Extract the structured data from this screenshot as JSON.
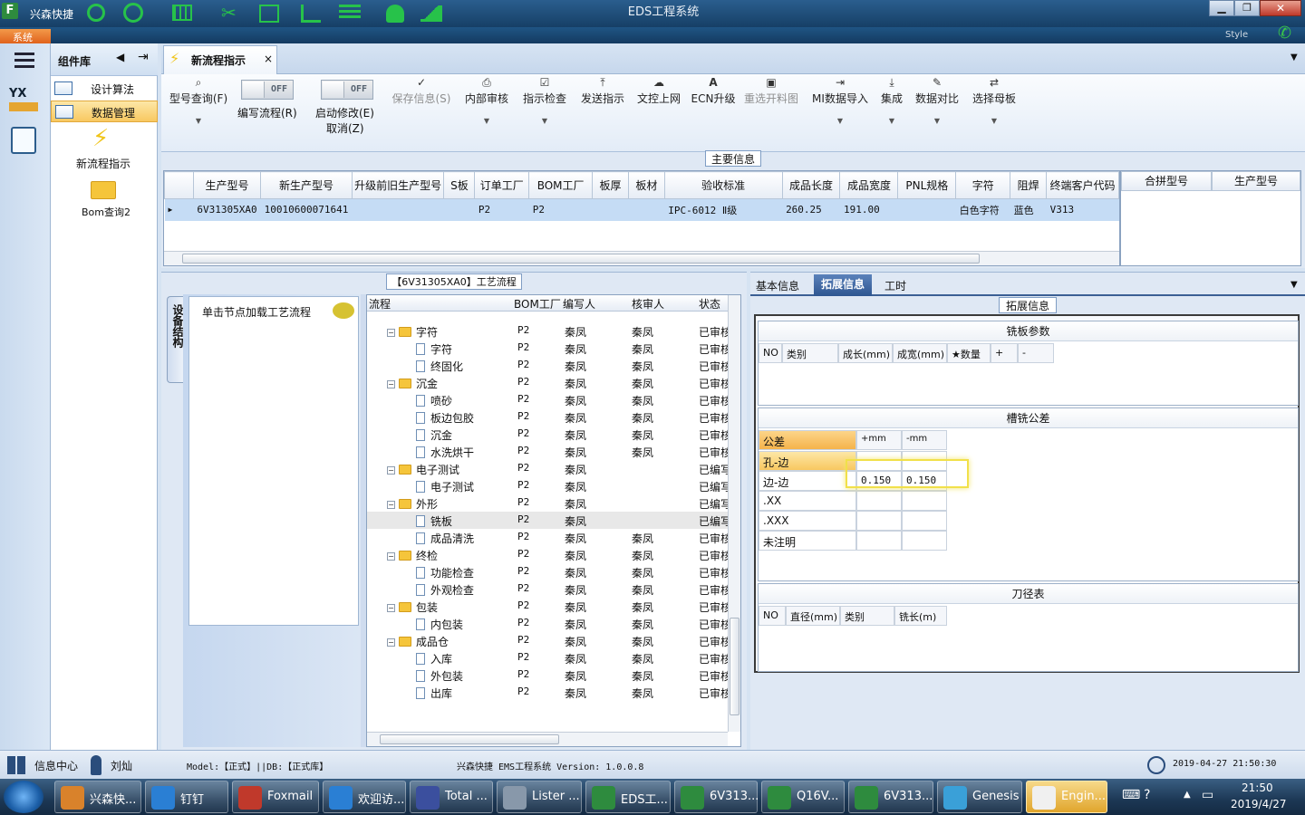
{
  "titlebar": {
    "app_short": "兴森快捷",
    "window_title": "EDS工程系统",
    "style_label": "Style"
  },
  "sysmenu": {
    "label": "系统"
  },
  "component_lib": {
    "title": "组件库",
    "items": [
      "设计算法",
      "数据管理"
    ],
    "tools": [
      "新流程指示",
      "Bom查询2"
    ]
  },
  "doc_tab": {
    "label": "新流程指示",
    "close": "×"
  },
  "ribbon": {
    "model_query": "型号查询(F)",
    "edit_flow_toggle": "OFF",
    "edit_flow": "编写流程(R)",
    "start_modify_toggle": "OFF",
    "start_modify": "启动修改(E)",
    "cancel": "取消(Z)",
    "save_info": "保存信息(S)",
    "internal_review": "内部审核",
    "indicate_check": "指示检查",
    "send_indicate": "发送指示",
    "doc_upload": "文控上网",
    "ecn_upgrade": "ECN升级",
    "reselect_chart": "重选开料图",
    "mi_import": "MI数据导入",
    "integrate": "集成",
    "data_compare": "数据对比",
    "select_mother": "选择母板"
  },
  "main_info": {
    "title": "主要信息",
    "columns": [
      "生产型号",
      "新生产型号",
      "升级前旧生产型号",
      "S板",
      "订单工厂",
      "BOM工厂",
      "板厚",
      "板材",
      "验收标准",
      "成品长度",
      "成品宽度",
      "PNL规格",
      "字符",
      "阻焊",
      "终端客户代码"
    ],
    "row": [
      "6V31305XA0",
      "10010600071641",
      "",
      "",
      "P2",
      "P2",
      "",
      "",
      "IPC-6012 Ⅱ级",
      "260.25",
      "191.00",
      "",
      "白色字符",
      "蓝色",
      "V313"
    ],
    "side_columns": [
      "合拼型号",
      "生产型号"
    ]
  },
  "process": {
    "title": "【6V31305XA0】工艺流程",
    "vertical_tab": "设备结构",
    "hint": "单击节点加载工艺流程",
    "columns": [
      "流程",
      "BOM工厂",
      "编写人",
      "核审人",
      "状态"
    ],
    "rows": [
      {
        "name": "字符",
        "folder": true,
        "bom": "P2",
        "author": "秦凤",
        "reviewer": "秦凤",
        "status": "已审核"
      },
      {
        "name": "字符",
        "folder": false,
        "bom": "P2",
        "author": "秦凤",
        "reviewer": "秦凤",
        "status": "已审核"
      },
      {
        "name": "终固化",
        "folder": false,
        "bom": "P2",
        "author": "秦凤",
        "reviewer": "秦凤",
        "status": "已审核"
      },
      {
        "name": "沉金",
        "folder": true,
        "bom": "P2",
        "author": "秦凤",
        "reviewer": "秦凤",
        "status": "已审核"
      },
      {
        "name": "喷砂",
        "folder": false,
        "bom": "P2",
        "author": "秦凤",
        "reviewer": "秦凤",
        "status": "已审核"
      },
      {
        "name": "板边包胶",
        "folder": false,
        "bom": "P2",
        "author": "秦凤",
        "reviewer": "秦凤",
        "status": "已审核"
      },
      {
        "name": "沉金",
        "folder": false,
        "bom": "P2",
        "author": "秦凤",
        "reviewer": "秦凤",
        "status": "已审核"
      },
      {
        "name": "水洗烘干",
        "folder": false,
        "bom": "P2",
        "author": "秦凤",
        "reviewer": "秦凤",
        "status": "已审核"
      },
      {
        "name": "电子测试",
        "folder": true,
        "bom": "P2",
        "author": "秦凤",
        "reviewer": "",
        "status": "已编写"
      },
      {
        "name": "电子测试",
        "folder": false,
        "bom": "P2",
        "author": "秦凤",
        "reviewer": "",
        "status": "已编写"
      },
      {
        "name": "外形",
        "folder": true,
        "bom": "P2",
        "author": "秦凤",
        "reviewer": "",
        "status": "已编写"
      },
      {
        "name": "铣板",
        "folder": false,
        "bom": "P2",
        "author": "秦凤",
        "reviewer": "",
        "status": "已编写"
      },
      {
        "name": "成品清洗",
        "folder": false,
        "bom": "P2",
        "author": "秦凤",
        "reviewer": "秦凤",
        "status": "已审核"
      },
      {
        "name": "终检",
        "folder": true,
        "bom": "P2",
        "author": "秦凤",
        "reviewer": "秦凤",
        "status": "已审核"
      },
      {
        "name": "功能检查",
        "folder": false,
        "bom": "P2",
        "author": "秦凤",
        "reviewer": "秦凤",
        "status": "已审核"
      },
      {
        "name": "外观检查",
        "folder": false,
        "bom": "P2",
        "author": "秦凤",
        "reviewer": "秦凤",
        "status": "已审核"
      },
      {
        "name": "包装",
        "folder": true,
        "bom": "P2",
        "author": "秦凤",
        "reviewer": "秦凤",
        "status": "已审核"
      },
      {
        "name": "内包装",
        "folder": false,
        "bom": "P2",
        "author": "秦凤",
        "reviewer": "秦凤",
        "status": "已审核"
      },
      {
        "name": "成品仓",
        "folder": true,
        "bom": "P2",
        "author": "秦凤",
        "reviewer": "秦凤",
        "status": "已审核"
      },
      {
        "name": "入库",
        "folder": false,
        "bom": "P2",
        "author": "秦凤",
        "reviewer": "秦凤",
        "status": "已审核"
      },
      {
        "name": "外包装",
        "folder": false,
        "bom": "P2",
        "author": "秦凤",
        "reviewer": "秦凤",
        "status": "已审核"
      },
      {
        "name": "出库",
        "folder": false,
        "bom": "P2",
        "author": "秦凤",
        "reviewer": "秦凤",
        "status": "已审核"
      }
    ]
  },
  "right_tabs": [
    "基本信息",
    "拓展信息",
    "工时"
  ],
  "ext": {
    "title": "拓展信息",
    "steel_title": "铣板参数",
    "steel_cols": [
      "NO",
      "类别",
      "成长(mm)",
      "成宽(mm)",
      "★数量",
      "+",
      "-"
    ],
    "slot_title": "槽铣公差",
    "slot_cols": [
      "公差",
      "+mm",
      "-mm"
    ],
    "slot_rows": [
      [
        "孔-边",
        "",
        ""
      ],
      [
        "边-边",
        "0.150",
        "0.150"
      ],
      [
        ".XX",
        "",
        ""
      ],
      [
        ".XXX",
        "",
        ""
      ],
      [
        "未注明",
        "",
        ""
      ]
    ],
    "tool_title": "刀径表",
    "tool_cols": [
      "NO",
      "直径(mm)",
      "类别",
      "铣长(m)"
    ]
  },
  "statusbar": {
    "info_center": "信息中心",
    "user": "刘灿",
    "model": "Model:【正式】||DB:【正式库】",
    "version": "兴森快捷 EMS工程系统 Version: 1.0.0.8",
    "datetime": "2019-04-27 21:50:30"
  },
  "taskbar": {
    "items": [
      "兴森快...",
      "钉钉",
      "Foxmail",
      "欢迎访...",
      "Total ...",
      "Lister ...",
      "EDS工...",
      "6V313...",
      "Q16V...",
      "6V313...",
      "Genesis",
      "Engin..."
    ],
    "time": "21:50",
    "date": "2019/4/27"
  }
}
